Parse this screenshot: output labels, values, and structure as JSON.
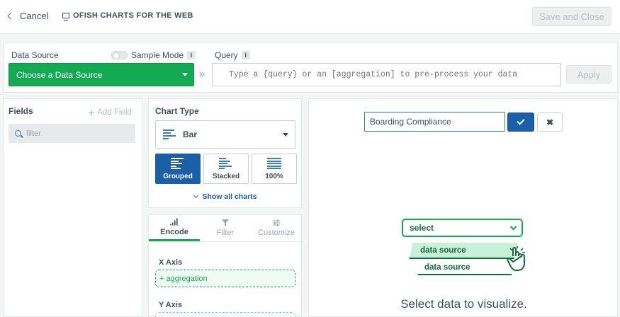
{
  "topbar": {
    "cancel_label": "Cancel",
    "doc_title": "OFISH CHARTS FOR THE WEB",
    "save_label": "Save and Close"
  },
  "datasource": {
    "label": "Data Source",
    "sample_mode_label": "Sample Mode",
    "info_badge": "i",
    "select_value": "Choose a Data Source",
    "separator": "»",
    "query_label": "Query",
    "query_placeholder": "Type a {query} or an [aggregation] to pre-process your data",
    "apply_label": "Apply"
  },
  "fields": {
    "title": "Fields",
    "add_label": "Add Field",
    "filter_placeholder": "filter"
  },
  "chart_type": {
    "title": "Chart Type",
    "selected": "Bar",
    "variants": [
      {
        "label": "Grouped",
        "active": true
      },
      {
        "label": "Stacked",
        "active": false
      },
      {
        "label": "100%",
        "active": false
      }
    ],
    "show_all_label": "Show all charts"
  },
  "encode": {
    "tabs": [
      {
        "label": "Encode",
        "icon": "bar-signal-icon",
        "active": true
      },
      {
        "label": "Filter",
        "icon": "funnel-icon",
        "active": false
      },
      {
        "label": "Customize",
        "icon": "sliders-icon",
        "active": false
      }
    ],
    "x_axis_label": "X Axis",
    "x_axis_drop": "+ aggregation",
    "y_axis_label": "Y Axis"
  },
  "canvas": {
    "title_value": "Boarding Compliance",
    "illustration": {
      "select_label": "select",
      "option_1": "data source",
      "option_2": "data source"
    },
    "empty_message": "Select data to visualize."
  },
  "colors": {
    "brand_green": "#13aa52",
    "primary_blue": "#1a5fa8",
    "text": "#3d4f58"
  }
}
